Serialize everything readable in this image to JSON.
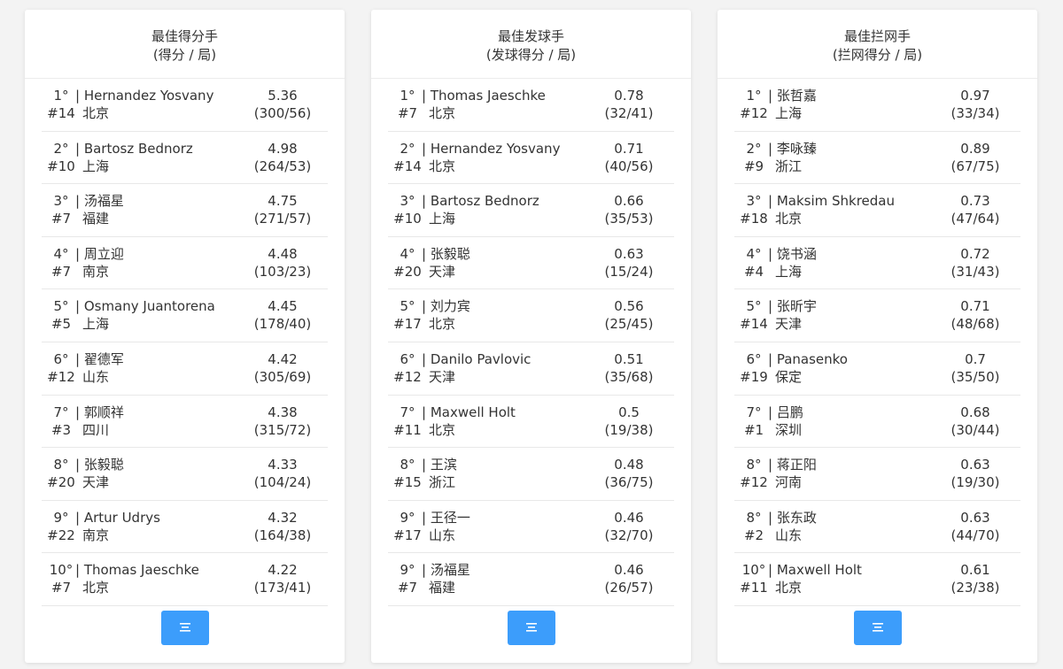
{
  "colors": {
    "accent": "#3c9dfb",
    "background": "#f3f3f3",
    "card": "#ffffff"
  },
  "menu_icon": "menu-lines-icon",
  "boards": [
    {
      "title": "最佳得分手",
      "subtitle": "(得分 / 局)",
      "rows": [
        {
          "rank": "1°",
          "num": "#14",
          "name": "| Hernandez Yosvany",
          "city": "北京",
          "value": "5.36",
          "frac": "(300/56)"
        },
        {
          "rank": "2°",
          "num": "#10",
          "name": "| Bartosz Bednorz",
          "city": "上海",
          "value": "4.98",
          "frac": "(264/53)"
        },
        {
          "rank": "3°",
          "num": "#7",
          "name": "| 汤福星",
          "city": "福建",
          "value": "4.75",
          "frac": "(271/57)"
        },
        {
          "rank": "4°",
          "num": "#7",
          "name": "| 周立迎",
          "city": "南京",
          "value": "4.48",
          "frac": "(103/23)"
        },
        {
          "rank": "5°",
          "num": "#5",
          "name": "| Osmany Juantorena",
          "city": "上海",
          "value": "4.45",
          "frac": "(178/40)"
        },
        {
          "rank": "6°",
          "num": "#12",
          "name": "| 翟德军",
          "city": "山东",
          "value": "4.42",
          "frac": "(305/69)"
        },
        {
          "rank": "7°",
          "num": "#3",
          "name": "| 郭顺祥",
          "city": "四川",
          "value": "4.38",
          "frac": "(315/72)"
        },
        {
          "rank": "8°",
          "num": "#20",
          "name": "| 张毅聪",
          "city": "天津",
          "value": "4.33",
          "frac": "(104/24)"
        },
        {
          "rank": "9°",
          "num": "#22",
          "name": "| Artur Udrys",
          "city": "南京",
          "value": "4.32",
          "frac": "(164/38)"
        },
        {
          "rank": "10°",
          "num": "#7",
          "name": "| Thomas Jaeschke",
          "city": "北京",
          "value": "4.22",
          "frac": "(173/41)"
        }
      ]
    },
    {
      "title": "最佳发球手",
      "subtitle": "(发球得分 / 局)",
      "rows": [
        {
          "rank": "1°",
          "num": "#7",
          "name": "| Thomas Jaeschke",
          "city": "北京",
          "value": "0.78",
          "frac": "(32/41)"
        },
        {
          "rank": "2°",
          "num": "#14",
          "name": "| Hernandez Yosvany",
          "city": "北京",
          "value": "0.71",
          "frac": "(40/56)"
        },
        {
          "rank": "3°",
          "num": "#10",
          "name": "| Bartosz Bednorz",
          "city": "上海",
          "value": "0.66",
          "frac": "(35/53)"
        },
        {
          "rank": "4°",
          "num": "#20",
          "name": "| 张毅聪",
          "city": "天津",
          "value": "0.63",
          "frac": "(15/24)"
        },
        {
          "rank": "5°",
          "num": "#17",
          "name": "| 刘力宾",
          "city": "北京",
          "value": "0.56",
          "frac": "(25/45)"
        },
        {
          "rank": "6°",
          "num": "#12",
          "name": "| Danilo Pavlovic",
          "city": "天津",
          "value": "0.51",
          "frac": "(35/68)"
        },
        {
          "rank": "7°",
          "num": "#11",
          "name": "| Maxwell Holt",
          "city": "北京",
          "value": "0.5",
          "frac": "(19/38)"
        },
        {
          "rank": "8°",
          "num": "#15",
          "name": "| 王滨",
          "city": "浙江",
          "value": "0.48",
          "frac": "(36/75)"
        },
        {
          "rank": "9°",
          "num": "#17",
          "name": "| 王径一",
          "city": "山东",
          "value": "0.46",
          "frac": "(32/70)"
        },
        {
          "rank": "9°",
          "num": "#7",
          "name": "| 汤福星",
          "city": "福建",
          "value": "0.46",
          "frac": "(26/57)"
        }
      ]
    },
    {
      "title": "最佳拦网手",
      "subtitle": "(拦网得分 / 局)",
      "rows": [
        {
          "rank": "1°",
          "num": "#12",
          "name": "| 张哲嘉",
          "city": "上海",
          "value": "0.97",
          "frac": "(33/34)"
        },
        {
          "rank": "2°",
          "num": "#9",
          "name": "| 李咏臻",
          "city": "浙江",
          "value": "0.89",
          "frac": "(67/75)"
        },
        {
          "rank": "3°",
          "num": "#18",
          "name": "| Maksim Shkredau",
          "city": "北京",
          "value": "0.73",
          "frac": "(47/64)"
        },
        {
          "rank": "4°",
          "num": "#4",
          "name": "| 饶书涵",
          "city": "上海",
          "value": "0.72",
          "frac": "(31/43)"
        },
        {
          "rank": "5°",
          "num": "#14",
          "name": "| 张昕宇",
          "city": "天津",
          "value": "0.71",
          "frac": "(48/68)"
        },
        {
          "rank": "6°",
          "num": "#19",
          "name": "| Panasenko",
          "city": "保定",
          "value": "0.7",
          "frac": "(35/50)"
        },
        {
          "rank": "7°",
          "num": "#1",
          "name": "| 吕鹏",
          "city": "深圳",
          "value": "0.68",
          "frac": "(30/44)"
        },
        {
          "rank": "8°",
          "num": "#12",
          "name": "| 蒋正阳",
          "city": "河南",
          "value": "0.63",
          "frac": "(19/30)"
        },
        {
          "rank": "8°",
          "num": "#2",
          "name": "| 张东政",
          "city": "山东",
          "value": "0.63",
          "frac": "(44/70)"
        },
        {
          "rank": "10°",
          "num": "#11",
          "name": "| Maxwell Holt",
          "city": "北京",
          "value": "0.61",
          "frac": "(23/38)"
        }
      ]
    }
  ]
}
